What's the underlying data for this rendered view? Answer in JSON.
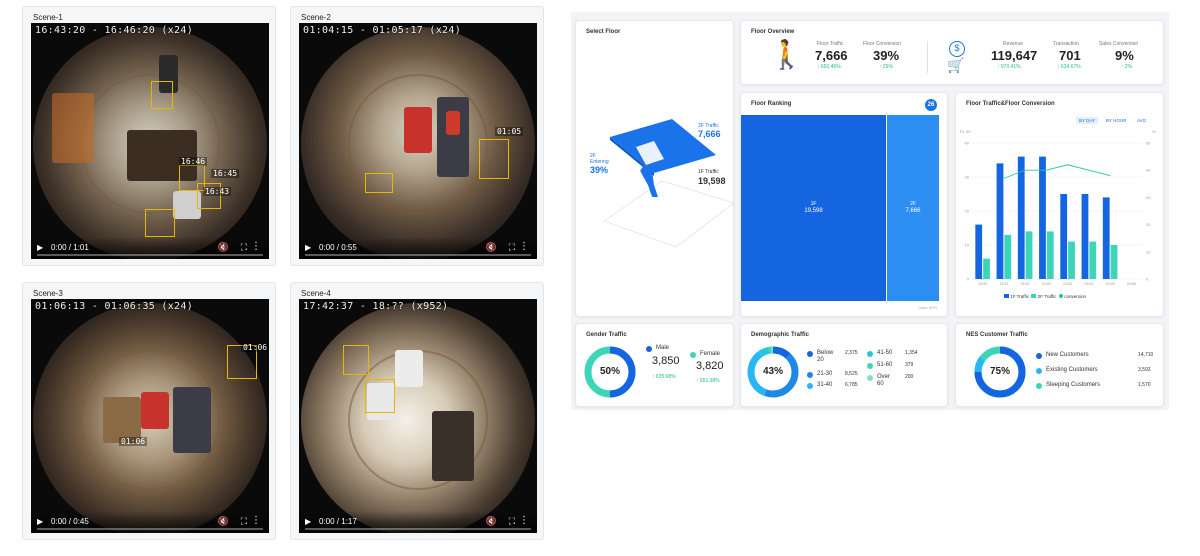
{
  "scenes": [
    {
      "title": "Scene-1",
      "timestamp": "16:43:20 - 16:46:20 (x24)",
      "time": "0:00 / 1:01",
      "labels": [
        "16:46",
        "16:43",
        "16:45"
      ]
    },
    {
      "title": "Scene-2",
      "timestamp": "01:04:15 - 01:05:17 (x24)",
      "time": "0:00 / 0:55",
      "labels": [
        "01:05"
      ]
    },
    {
      "title": "Scene-3",
      "timestamp": "01:06:13 - 01:06:35 (x24)",
      "time": "0:00 / 0:45",
      "labels": [
        "01:06",
        "01:06"
      ]
    },
    {
      "title": "Scene-4",
      "timestamp": "17:42:37 - 18:?? (x952)",
      "time": "0:00 / 1:17",
      "labels": []
    }
  ],
  "select_floor": {
    "title": "Select Floor",
    "label_2f_traffic": "2F Traffic",
    "value_2f_traffic": "7,666",
    "label_2f_entering": "2F Entering",
    "value_2f_entering": "39%",
    "label_1f_traffic": "1F Traffic",
    "value_1f_traffic": "19,598"
  },
  "floor_overview": {
    "title": "Floor Overview",
    "floor_traffic_label": "Floor Traffic",
    "floor_traffic": "7,666",
    "floor_traffic_delta": "↑ 650.46%",
    "floor_conversion_label": "Floor Conversion",
    "floor_conversion": "39%",
    "floor_conversion_delta": "↑ 25%",
    "revenue_label": "Revenue",
    "revenue": "119,647",
    "revenue_delta": "↑ 970.41%",
    "transaction_label": "Transaction",
    "transaction": "701",
    "transaction_delta": "↑ 634.67%",
    "sales_conversion_label": "Sales Conversion",
    "sales_conversion": "9%",
    "sales_conversion_delta": "↑ 2%"
  },
  "floor_ranking": {
    "title": "Floor Ranking",
    "badge": "26",
    "floor_1f_label": "1F",
    "floor_1f_value": "19,598",
    "floor_2f_label": "2F",
    "floor_2f_value": "7,666",
    "footer": "Data: APR"
  },
  "traffic_conversion": {
    "title": "Floor Traffic&Floor Conversion",
    "tabs": [
      "BY DAY",
      "BY HOUR",
      "AVG"
    ],
    "left_unit": "PL.00",
    "right_unit": "%"
  },
  "chart_data": {
    "type": "bar",
    "categories": [
      "12/30",
      "12/31",
      "01/01",
      "01/02",
      "01/03",
      "01/04",
      "01/05",
      "01/06"
    ],
    "series": [
      {
        "name": "1F Traffic",
        "values": [
          16,
          34,
          36,
          36,
          25,
          25,
          24,
          0
        ],
        "color": "#1565e0"
      },
      {
        "name": "2F Traffic",
        "values": [
          6,
          13,
          14,
          14,
          11,
          11,
          10,
          0
        ],
        "color": "#3dd5b8"
      },
      {
        "name": "conversion",
        "values": [
          null,
          37,
          40,
          40,
          42,
          40,
          38,
          null
        ],
        "color": "#22c6a4",
        "type": "line"
      }
    ],
    "ylim_left": [
      0,
      40
    ],
    "yticks_left": [
      0,
      10,
      20,
      30,
      40
    ],
    "ylim_right": [
      0,
      50
    ],
    "yticks_right": [
      0,
      10,
      20,
      30,
      40,
      50
    ]
  },
  "gender_traffic": {
    "title": "Gender Traffic",
    "center": "50%",
    "male_label": "Male",
    "male_value": "3,850",
    "male_delta": "↑ 635.68%",
    "female_label": "Female",
    "female_value": "3,820",
    "female_delta": "↑ 651.38%",
    "colors": {
      "male": "#1565e0",
      "female": "#3dd5b8"
    }
  },
  "demographic_traffic": {
    "title": "Demographic Traffic",
    "center": "43%",
    "groups": [
      {
        "label": "Below 20",
        "value": "2,375",
        "color": "#1565e0"
      },
      {
        "label": "21-30",
        "value": "8,525",
        "color": "#1e88e5"
      },
      {
        "label": "31-40",
        "value": "6,785",
        "color": "#29b6f6"
      },
      {
        "label": "41-50",
        "value": "1,354",
        "color": "#26c6da"
      },
      {
        "label": "51-60",
        "value": "379",
        "color": "#3dd5b8"
      },
      {
        "label": "Over 60",
        "value": "200",
        "color": "#80e0c8"
      }
    ]
  },
  "nes_customer": {
    "title": "NES Customer Traffic",
    "center": "75%",
    "items": [
      {
        "label": "New Customers",
        "value": "14,710",
        "color": "#1565e0"
      },
      {
        "label": "Existing Customers",
        "value": "3,593",
        "color": "#29b6f6"
      },
      {
        "label": "Sleeping Customers",
        "value": "1,570",
        "color": "#3dd5b8"
      }
    ]
  }
}
